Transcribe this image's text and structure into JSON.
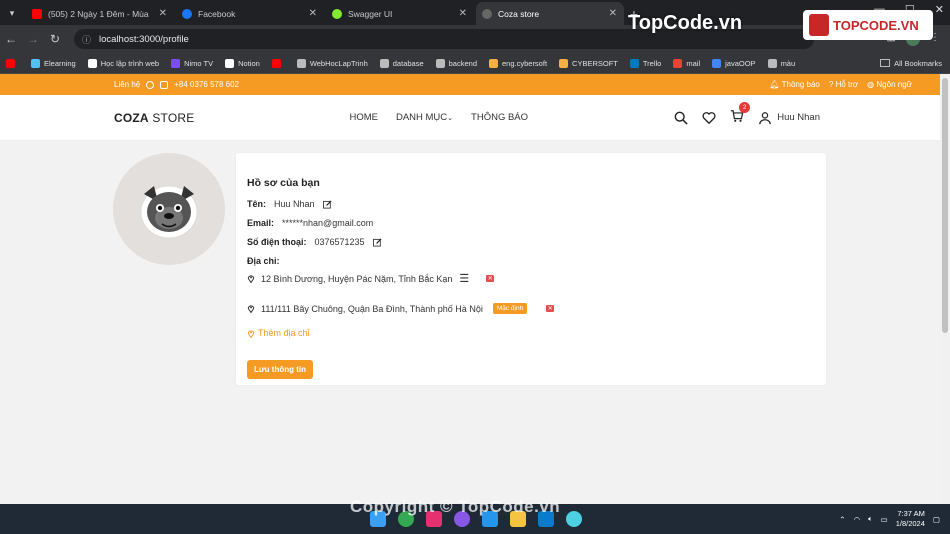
{
  "browser": {
    "tabs": [
      {
        "title": "(505) 2 Ngày 1 Đêm - Mùa",
        "icon": "youtube-icon",
        "color": "#ff0000"
      },
      {
        "title": "Facebook",
        "icon": "facebook-icon",
        "color": "#1877f2"
      },
      {
        "title": "Swagger UI",
        "icon": "swagger-icon",
        "color": "#85ea2d"
      },
      {
        "title": "Coza store",
        "icon": "globe-icon",
        "color": "#666666"
      }
    ],
    "url": "localhost:3000/profile",
    "bookmarks": [
      {
        "label": "",
        "color": "#ff0000"
      },
      {
        "label": "Elearning",
        "color": "#4fc3f7"
      },
      {
        "label": "Học lập trình web",
        "color": "#ffffff"
      },
      {
        "label": "Nimo TV",
        "color": "#7c4dff"
      },
      {
        "label": "Notion",
        "color": "#ffffff"
      },
      {
        "label": "",
        "color": "#ff0000"
      },
      {
        "label": "WebHocLapTrinh",
        "color": "#bbbbbb"
      },
      {
        "label": "database",
        "color": "#bbbbbb"
      },
      {
        "label": "backend",
        "color": "#bbbbbb"
      },
      {
        "label": "eng.cybersoft",
        "color": "#f5b041"
      },
      {
        "label": "CYBERSOFT",
        "color": "#f5b041"
      },
      {
        "label": "Trello",
        "color": "#0079bf"
      },
      {
        "label": "mail",
        "color": "#ea4335"
      },
      {
        "label": "javaOOP",
        "color": "#4285f4"
      },
      {
        "label": "màu",
        "color": "#bbbbbb"
      }
    ],
    "all_bookmarks": "All Bookmarks"
  },
  "topbar": {
    "contact": "Liên hệ",
    "phone": "+84 0376 578 602",
    "notify": "Thông báo",
    "help": "Hỗ trợ",
    "language": "Ngôn ngữ"
  },
  "header": {
    "logo_bold": "COZA",
    "logo_rest": " STORE",
    "menu": [
      "HOME",
      "DANH MỤC",
      "THÔNG BÁO"
    ],
    "cart_count": "2",
    "user_name": "Huu Nhan"
  },
  "profile": {
    "title": "Hồ sơ của bạn",
    "name_label": "Tên:",
    "name": "Huu Nhan",
    "email_label": "Email:",
    "email": "******nhan@gmail.com",
    "phone_label": "Số điện thoại:",
    "phone": "0376571235",
    "address_label": "Địa chỉ:",
    "addresses": [
      {
        "text": "12 Bình Dương, Huyện Pác Nặm, Tỉnh Bắc Kạn",
        "default": false
      },
      {
        "text": "111/111 Bãy Chuông, Quận Ba Đình, Thành phố Hà Nội",
        "default": true
      }
    ],
    "default_label": "Mặc định",
    "add_address": "Thêm địa chỉ",
    "save_button": "Lưu thông tin"
  },
  "watermark": {
    "top": "TopCode.vn",
    "logo": "TOPCODE.VN",
    "bottom": "Copyright © TopCode.vn"
  },
  "taskbar": {
    "time": "7:37 AM",
    "date": "1/8/2024"
  },
  "colors": {
    "accent": "#f59a23",
    "danger": "#e05050"
  }
}
